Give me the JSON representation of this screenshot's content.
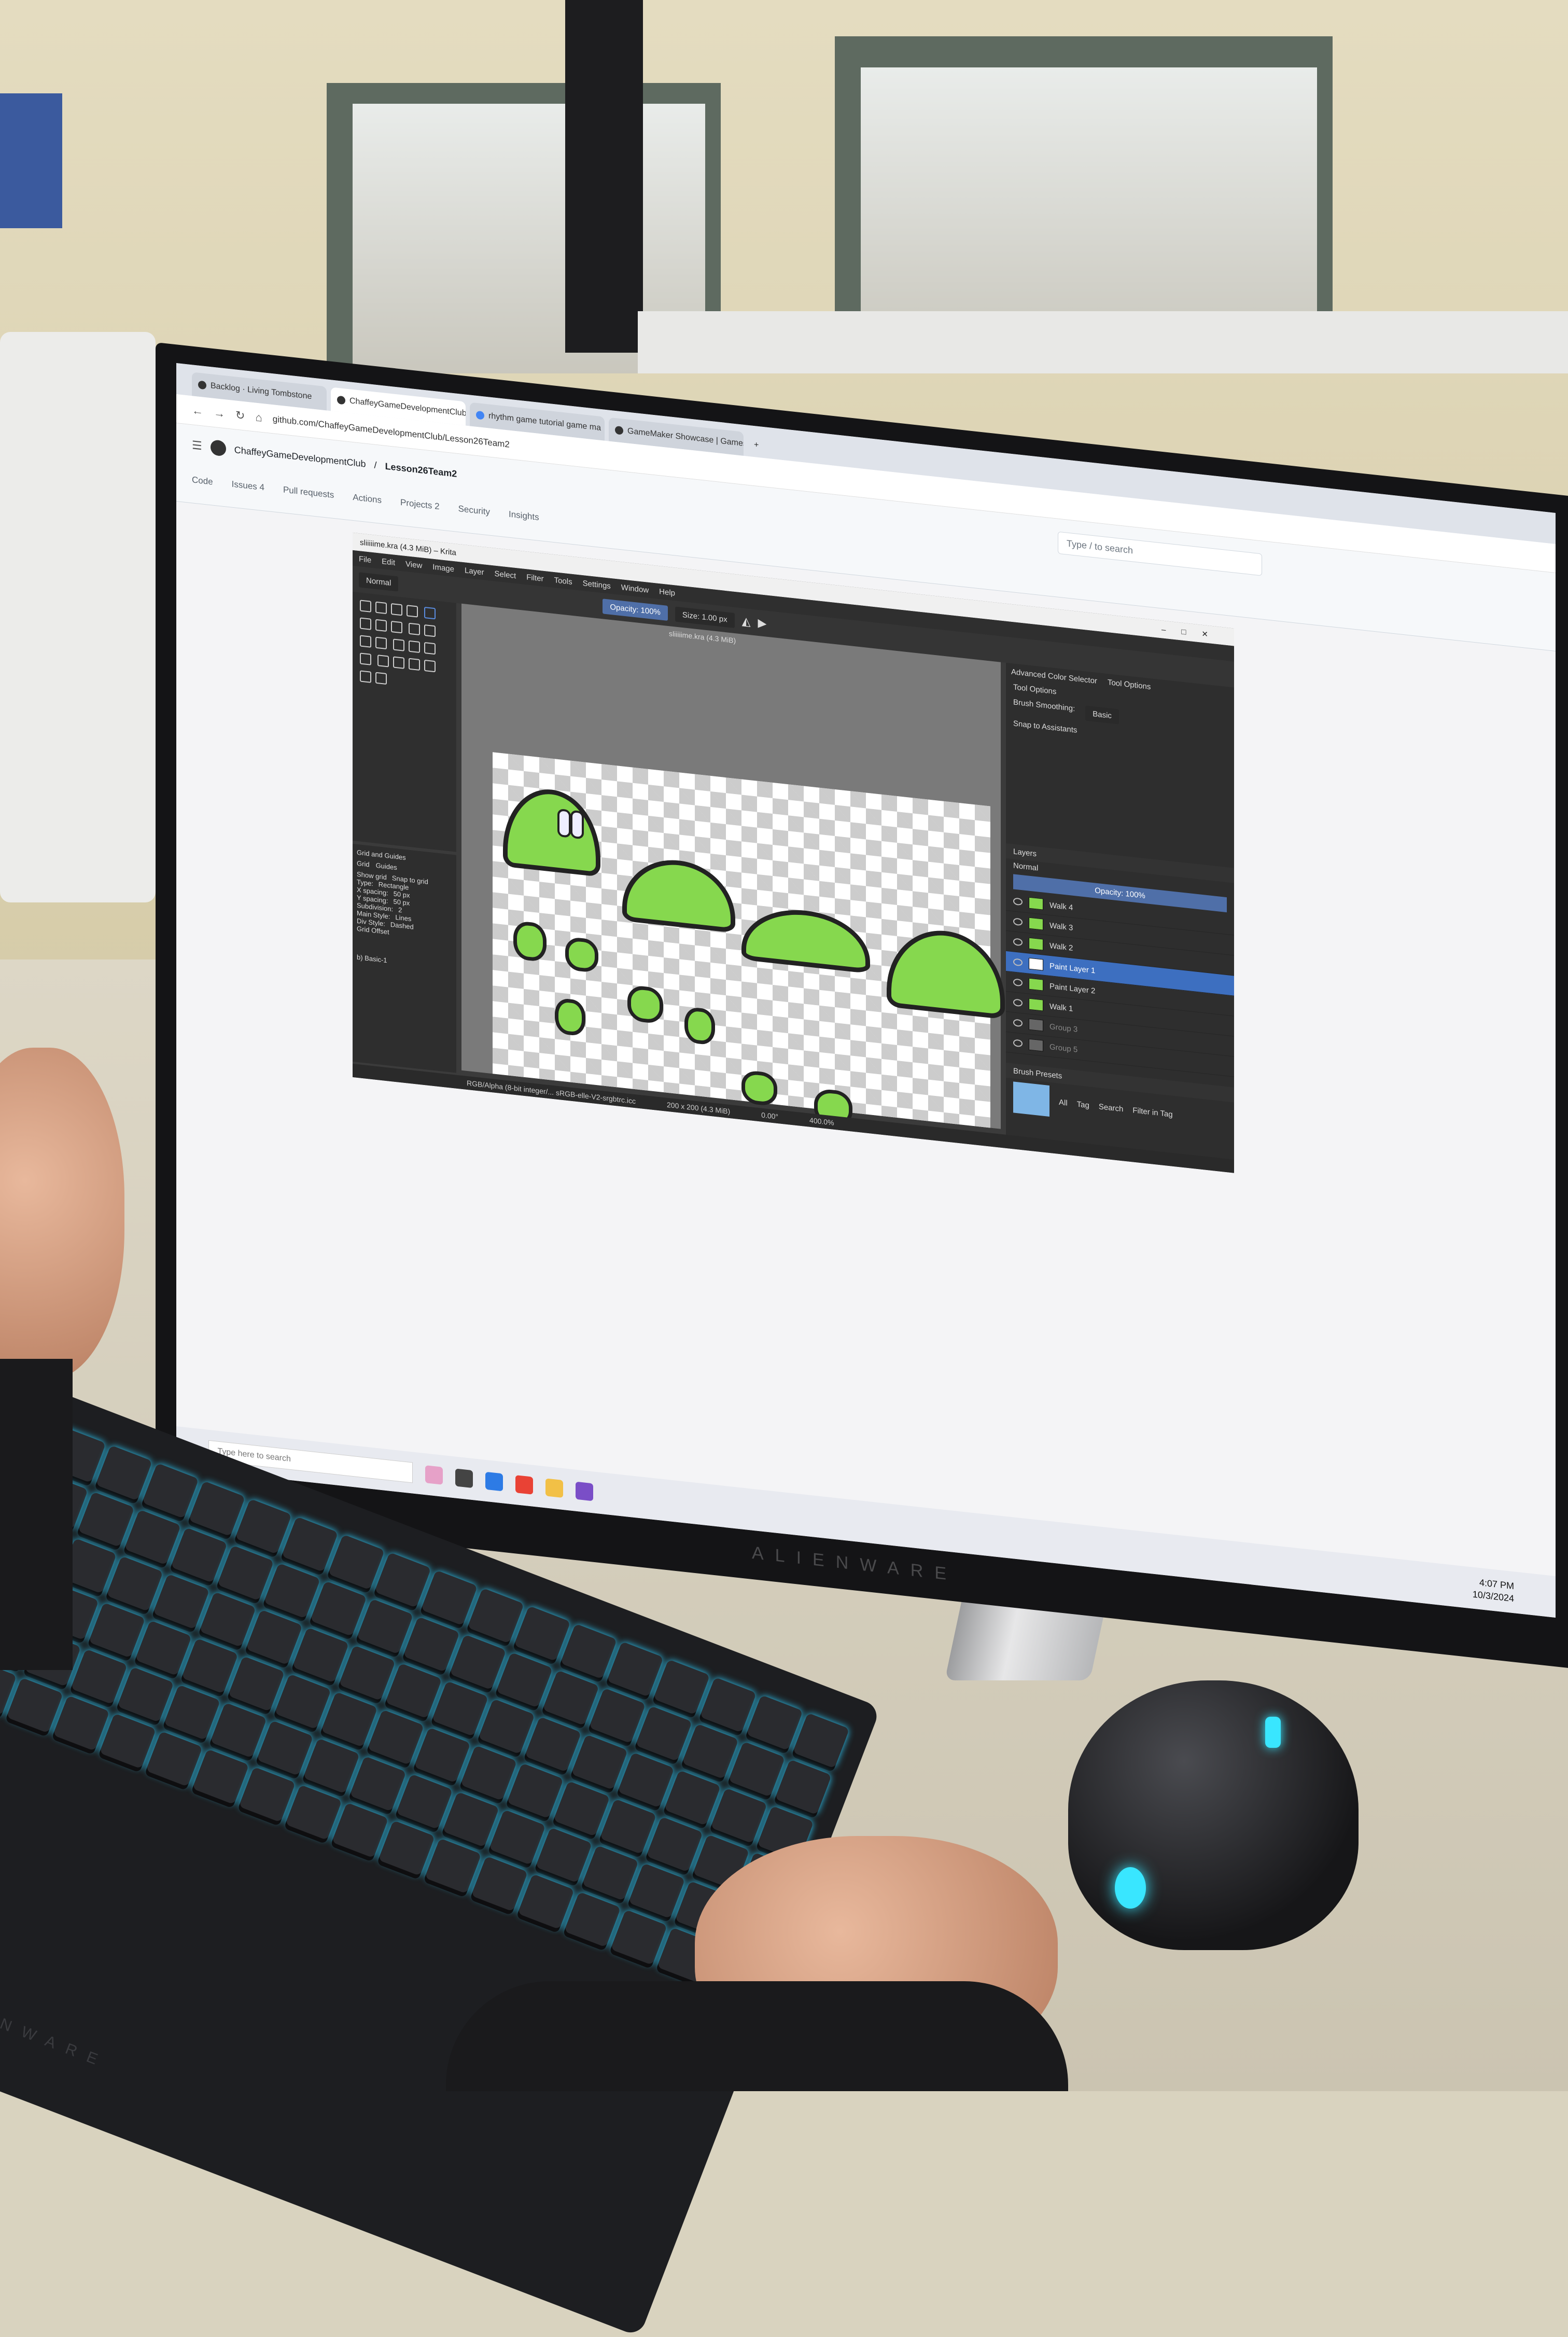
{
  "browser": {
    "tabs": [
      {
        "label": "Backlog · Living Tombstone"
      },
      {
        "label": "ChaffeyGameDevelopmentClub",
        "active": true
      },
      {
        "label": "rhythm game tutorial game ma"
      },
      {
        "label": "GameMaker Showcase | Games"
      }
    ],
    "new_tab": "+",
    "url": "github.com/ChaffeyGameDevelopmentClub/Lesson26Team2"
  },
  "github": {
    "org": "ChaffeyGameDevelopmentClub",
    "repo": "Lesson26Team2",
    "search_placeholder": "Type / to search",
    "nav": [
      "Code",
      "Issues 4",
      "Pull requests",
      "Actions",
      "Projects 2",
      "Security",
      "Insights"
    ]
  },
  "krita": {
    "window_title": "sliiiiime.kra (4.3 MiB) – Krita",
    "menu": [
      "File",
      "Edit",
      "View",
      "Image",
      "Layer",
      "Select",
      "Filter",
      "Tools",
      "Settings",
      "Window",
      "Help"
    ],
    "blend_mode": "Normal",
    "opacity": "Opacity: 100%",
    "size": "Size: 1.00 px",
    "doc_tab": "sliiiiime.kra (4.3 MiB)",
    "docker_tabs": [
      "Advanced Color Selector",
      "Tool Options"
    ],
    "tool_options_title": "Tool Options",
    "brush_smoothing_label": "Brush Smoothing:",
    "brush_smoothing_value": "Basic",
    "snap_label": "Snap to Assistants",
    "grid_title": "Grid and Guides",
    "grid_tabs": [
      "Grid",
      "Guides"
    ],
    "grid_fields": [
      "Show grid",
      "Snap to grid",
      "Type:",
      "Rectangle",
      "X spacing:",
      "50 px",
      "Y spacing:",
      "50 px",
      "Subdivision:",
      "2",
      "Main Style:",
      "Lines",
      "Div Style:",
      "Dashed",
      "Grid Offset"
    ],
    "layers_title": "Layers",
    "layers_blend": "Normal",
    "layers_opacity": "Opacity: 100%",
    "layers": [
      {
        "name": "Walk 4"
      },
      {
        "name": "Walk 3"
      },
      {
        "name": "Walk 2"
      },
      {
        "name": "Paint Layer 1",
        "selected": true
      },
      {
        "name": "Paint Layer 2"
      },
      {
        "name": "Walk 1"
      },
      {
        "name": "Group 3"
      },
      {
        "name": "Group 5"
      }
    ],
    "brush_presets_title": "Brush Presets",
    "brush_filter": "All",
    "brush_tag": "Tag",
    "brush_search": "Search",
    "filter_in_tag": "Filter in Tag",
    "status_left": "RGB/Alpha (8-bit integer/... sRGB-elle-V2-srgbtrc.icc",
    "status_size": "200 x 200 (4.3 MiB)",
    "status_angle": "0.00°",
    "zoom": "400.0%",
    "brush_name": "b) Basic-1"
  },
  "taskbar": {
    "search": "Type here to search",
    "time": "4:07 PM",
    "date": "10/3/2024"
  },
  "hardware": {
    "monitor_brand": "ALIENWARE",
    "keyboard_brand": "ALIENWARE"
  },
  "colors": {
    "slime_green": "#86d84e",
    "krita_selection": "#3d6fc0",
    "key_glow": "#2fd0ff"
  }
}
